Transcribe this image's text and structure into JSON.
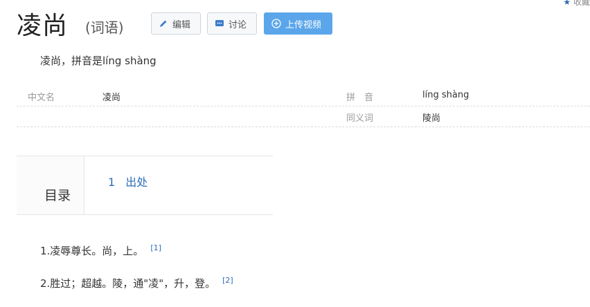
{
  "header": {
    "title": "凌尚",
    "subtitle": "(词语)",
    "favorite_label": "收藏"
  },
  "toolbar": {
    "edit_label": "编辑",
    "discuss_label": "讨论",
    "upload_video_label": "上传视频"
  },
  "summary": "凌尚，拼音是líng shàng",
  "basic_info": {
    "rows": [
      {
        "label1": "中文名",
        "value1": "凌尚",
        "label2": "拼　音",
        "value2": "líng shàng"
      },
      {
        "label1": "",
        "value1": "",
        "label2": "同义词",
        "value2": "陵尚"
      }
    ]
  },
  "toc": {
    "title": "目录",
    "items": [
      {
        "num": "1",
        "label": "出处"
      }
    ]
  },
  "definitions": [
    {
      "text": "1.凌辱尊长。尚，上。",
      "ref": "[1]"
    },
    {
      "text": "2.胜过；超越。陵，通\"凌\"，升，登。",
      "ref": "[2]"
    }
  ],
  "colors": {
    "accent": "#5ba6ea",
    "link": "#2c6bb8"
  }
}
